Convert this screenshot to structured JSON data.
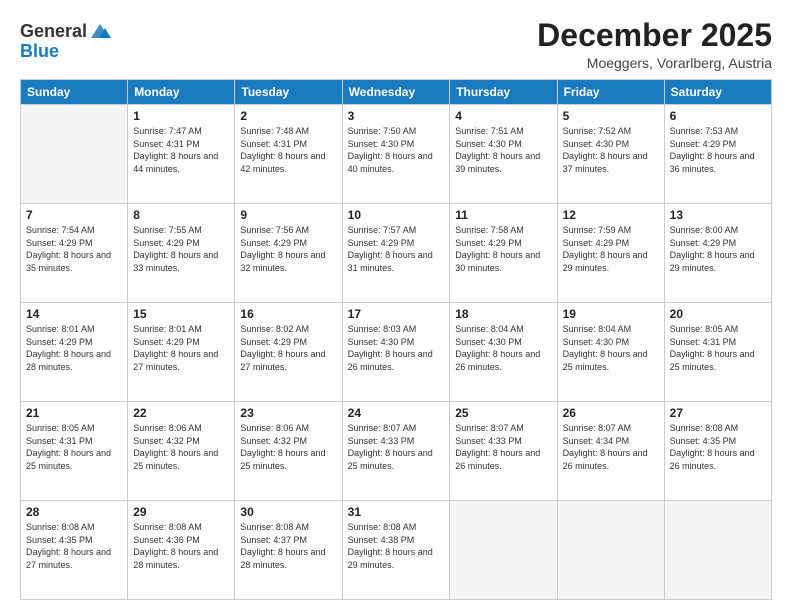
{
  "logo": {
    "general": "General",
    "blue": "Blue"
  },
  "header": {
    "month": "December 2025",
    "location": "Moeggers, Vorarlberg, Austria"
  },
  "days_of_week": [
    "Sunday",
    "Monday",
    "Tuesday",
    "Wednesday",
    "Thursday",
    "Friday",
    "Saturday"
  ],
  "weeks": [
    [
      {
        "num": "",
        "empty": true
      },
      {
        "num": "1",
        "sunrise": "7:47 AM",
        "sunset": "4:31 PM",
        "daylight": "8 hours and 44 minutes."
      },
      {
        "num": "2",
        "sunrise": "7:48 AM",
        "sunset": "4:31 PM",
        "daylight": "8 hours and 42 minutes."
      },
      {
        "num": "3",
        "sunrise": "7:50 AM",
        "sunset": "4:30 PM",
        "daylight": "8 hours and 40 minutes."
      },
      {
        "num": "4",
        "sunrise": "7:51 AM",
        "sunset": "4:30 PM",
        "daylight": "8 hours and 39 minutes."
      },
      {
        "num": "5",
        "sunrise": "7:52 AM",
        "sunset": "4:30 PM",
        "daylight": "8 hours and 37 minutes."
      },
      {
        "num": "6",
        "sunrise": "7:53 AM",
        "sunset": "4:29 PM",
        "daylight": "8 hours and 36 minutes."
      }
    ],
    [
      {
        "num": "7",
        "sunrise": "7:54 AM",
        "sunset": "4:29 PM",
        "daylight": "8 hours and 35 minutes."
      },
      {
        "num": "8",
        "sunrise": "7:55 AM",
        "sunset": "4:29 PM",
        "daylight": "8 hours and 33 minutes."
      },
      {
        "num": "9",
        "sunrise": "7:56 AM",
        "sunset": "4:29 PM",
        "daylight": "8 hours and 32 minutes."
      },
      {
        "num": "10",
        "sunrise": "7:57 AM",
        "sunset": "4:29 PM",
        "daylight": "8 hours and 31 minutes."
      },
      {
        "num": "11",
        "sunrise": "7:58 AM",
        "sunset": "4:29 PM",
        "daylight": "8 hours and 30 minutes."
      },
      {
        "num": "12",
        "sunrise": "7:59 AM",
        "sunset": "4:29 PM",
        "daylight": "8 hours and 29 minutes."
      },
      {
        "num": "13",
        "sunrise": "8:00 AM",
        "sunset": "4:29 PM",
        "daylight": "8 hours and 29 minutes."
      }
    ],
    [
      {
        "num": "14",
        "sunrise": "8:01 AM",
        "sunset": "4:29 PM",
        "daylight": "8 hours and 28 minutes."
      },
      {
        "num": "15",
        "sunrise": "8:01 AM",
        "sunset": "4:29 PM",
        "daylight": "8 hours and 27 minutes."
      },
      {
        "num": "16",
        "sunrise": "8:02 AM",
        "sunset": "4:29 PM",
        "daylight": "8 hours and 27 minutes."
      },
      {
        "num": "17",
        "sunrise": "8:03 AM",
        "sunset": "4:30 PM",
        "daylight": "8 hours and 26 minutes."
      },
      {
        "num": "18",
        "sunrise": "8:04 AM",
        "sunset": "4:30 PM",
        "daylight": "8 hours and 26 minutes."
      },
      {
        "num": "19",
        "sunrise": "8:04 AM",
        "sunset": "4:30 PM",
        "daylight": "8 hours and 25 minutes."
      },
      {
        "num": "20",
        "sunrise": "8:05 AM",
        "sunset": "4:31 PM",
        "daylight": "8 hours and 25 minutes."
      }
    ],
    [
      {
        "num": "21",
        "sunrise": "8:05 AM",
        "sunset": "4:31 PM",
        "daylight": "8 hours and 25 minutes."
      },
      {
        "num": "22",
        "sunrise": "8:06 AM",
        "sunset": "4:32 PM",
        "daylight": "8 hours and 25 minutes."
      },
      {
        "num": "23",
        "sunrise": "8:06 AM",
        "sunset": "4:32 PM",
        "daylight": "8 hours and 25 minutes."
      },
      {
        "num": "24",
        "sunrise": "8:07 AM",
        "sunset": "4:33 PM",
        "daylight": "8 hours and 25 minutes."
      },
      {
        "num": "25",
        "sunrise": "8:07 AM",
        "sunset": "4:33 PM",
        "daylight": "8 hours and 26 minutes."
      },
      {
        "num": "26",
        "sunrise": "8:07 AM",
        "sunset": "4:34 PM",
        "daylight": "8 hours and 26 minutes."
      },
      {
        "num": "27",
        "sunrise": "8:08 AM",
        "sunset": "4:35 PM",
        "daylight": "8 hours and 26 minutes."
      }
    ],
    [
      {
        "num": "28",
        "sunrise": "8:08 AM",
        "sunset": "4:35 PM",
        "daylight": "8 hours and 27 minutes."
      },
      {
        "num": "29",
        "sunrise": "8:08 AM",
        "sunset": "4:36 PM",
        "daylight": "8 hours and 28 minutes."
      },
      {
        "num": "30",
        "sunrise": "8:08 AM",
        "sunset": "4:37 PM",
        "daylight": "8 hours and 28 minutes."
      },
      {
        "num": "31",
        "sunrise": "8:08 AM",
        "sunset": "4:38 PM",
        "daylight": "8 hours and 29 minutes."
      },
      {
        "num": "",
        "empty": true
      },
      {
        "num": "",
        "empty": true
      },
      {
        "num": "",
        "empty": true
      }
    ]
  ]
}
